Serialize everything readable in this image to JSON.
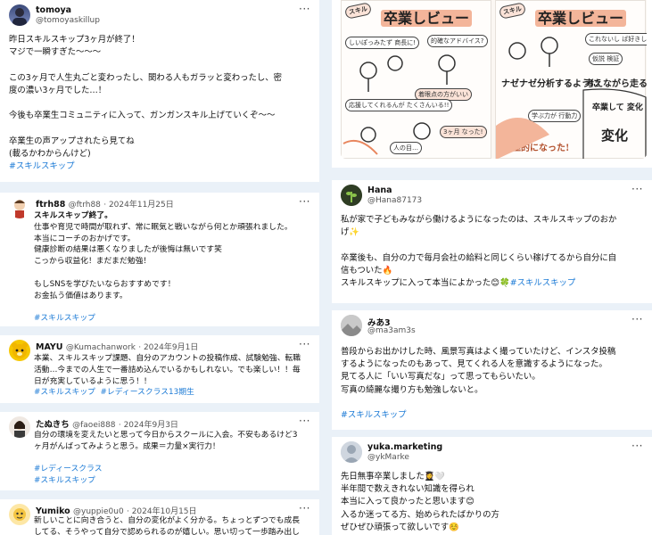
{
  "left": [
    {
      "name": "tomoya",
      "handle": "@tomoyaskillup",
      "lines": [
        "昨日スキルスキップ3ヶ月が終了！",
        "マジで一瞬すぎた〜〜〜",
        "",
        "この3ヶ月で人生丸ごと変わったし、関わる人もガラッと変わったし、密",
        "度の濃い3ヶ月でした…！",
        "",
        "今後も卒業生コミュニティに入って、ガンガンスキル上げていくぞ〜〜",
        "",
        "卒業生の声アップされたら見てね",
        "(載るかわからんけど)"
      ],
      "tags": [
        "#スキルスキップ"
      ]
    },
    {
      "name": "ftrh88",
      "handle": "@ftrh88",
      "date": "· 2024年11月25日",
      "lines": [
        "スキルスキップ終了。",
        "仕事や育児で時間が取れず、常に眠気と戦いながら何とか頑張れました。",
        "本当にコーチのおかげです。",
        "健康診断の結果は悪くなりましたが後悔は無いです笑",
        "こっから収益化！まだまだ勉強！",
        "",
        "もしSNSを学びたいならおすすめです！",
        "お金払う価値はあります。"
      ],
      "tags": [
        "#スキルスキップ"
      ]
    },
    {
      "name": "MAYU",
      "handle": "@Kumachanwork",
      "date": "· 2024年9月1日",
      "lines": [
        "本業、スキルスキップ課題、自分のアカウントの投稿作成、試験勉強、転職",
        "活動…今までの人生で一番詰め込んでいるかもしれない。でも楽しい！！毎",
        "日が充実しているように思う！！"
      ],
      "tags": [
        "#スキルスキップ",
        "#レディースクラス13期生"
      ]
    },
    {
      "name": "たぬきち",
      "handle": "@faoei888",
      "date": "· 2024年9月3日",
      "lines": [
        "自分の環境を変えたいと思って今日からスクールに入会。不安もあるけど3",
        "ヶ月がんばってみようと思う。成果＝力量×実行力！"
      ],
      "tags": [
        "#レディースクラス",
        "#スキルスキップ"
      ]
    },
    {
      "name": "Yumiko",
      "handle": "@yuppie0u0",
      "date": "· 2024年10月15日",
      "lines": [
        "新しいことに向き合うと、自分の変化がよく分かる。ちょっとずつでも成長",
        "してる、そうやって自分で認められるのが嬉しい。思い切って一歩踏み出し"
      ],
      "tags": []
    }
  ],
  "right": [
    {
      "illustration": {
        "panel_titles": [
          "卒業しビュー",
          "卒業しビュー"
        ],
        "stamps": [
          "スキル",
          "スキル"
        ],
        "notes_left": [
          "しいぽっみたず 商長に!",
          "的確なアドバイス?",
          "着眼点の方がいい",
          "応援してくれるんが たくさんいる!!",
          "3ヶ月 なった!",
          "人の目…"
        ],
        "notes_right": [
          "これないし ば好きしてない!",
          "仮説 検証",
          "ナゼナゼ分析するように",
          "考えながら走る",
          "学ぶ力が 行動力",
          "卒業して 変化",
          "積極的 なった!"
        ],
        "big_notes": [
          "ナゼナゼ分析するように",
          "積極的になった!",
          "変化"
        ]
      }
    },
    {
      "name": "Hana",
      "handle": "@Hana87173",
      "lines": [
        "私が家で子どもみながら働けるようになったのは、スキルスキップのおか",
        "げ✨",
        "",
        "卒業後も、自分の力で毎月会社の給料と同じくらい稼げてるから自分に自",
        "信もついた🔥"
      ],
      "last_line": "スキルスキップに入って本当によかった😊🍀",
      "tags": [
        "#スキルスキップ"
      ]
    },
    {
      "name": "みあ3",
      "handle": "@ma3am3s",
      "lines": [
        "普段からお出かけした時、風景写真はよく撮っていたけど、インスタ投稿",
        "するようになったのもあって、見てくれる人を意識するようになった。",
        "見てる人に「いい写真だな」って思ってもらいたい。",
        "写真の綺麗な撮り方も勉強しないと。"
      ],
      "tags": [
        "#スキルスキップ"
      ]
    },
    {
      "name": "yuka.marketing",
      "handle": "@ykMarke",
      "lines": [
        "先日無事卒業しました👩‍🎓🤍",
        "半年間で数えきれない知識を得られ",
        "本当に入って良かったと思います😊",
        "入るか迷ってる方、始められたばかりの方",
        "ぜひぜひ頑張って欲しいです☺️"
      ],
      "tags": []
    }
  ],
  "more_label": "···",
  "colors": {
    "accent": "#1d7bd6",
    "background": "#eaf1f8",
    "card": "#ffffff"
  }
}
